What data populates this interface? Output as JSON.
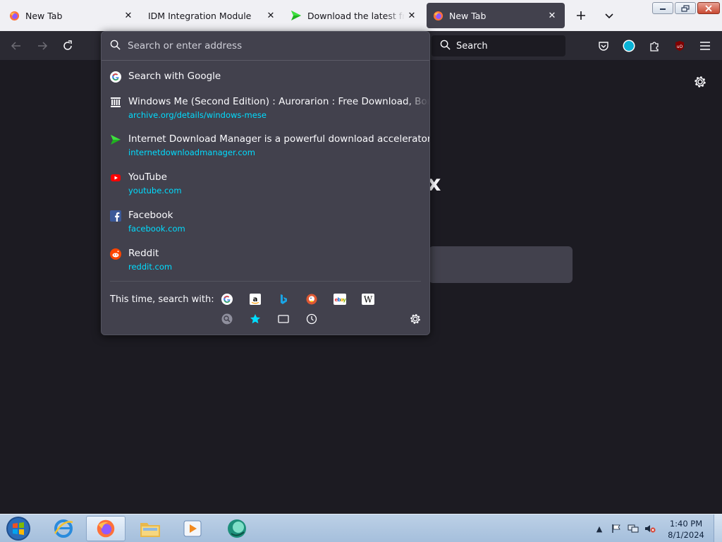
{
  "tabs": [
    {
      "title": "New Tab",
      "icon": "firefox-icon",
      "active": false
    },
    {
      "title": "IDM Integration Module",
      "icon": "none",
      "active": false
    },
    {
      "title": "Download the latest free trial",
      "icon": "idm-arrow-icon",
      "active": false
    },
    {
      "title": "New Tab",
      "icon": "firefox-icon",
      "active": true
    }
  ],
  "urlbar": {
    "placeholder": "Search or enter address"
  },
  "searchbar": {
    "placeholder": "Search"
  },
  "results": [
    {
      "title": "Search with Google",
      "url": "",
      "icon": "google-icon"
    },
    {
      "title": "Windows Me (Second Edition) : Aurorarion : Free Download, Borrow, and Streaming",
      "url": "archive.org/details/windows-mese",
      "icon": "archive-org-icon"
    },
    {
      "title": "Internet Download Manager is a powerful download accelerator",
      "url": "internetdownloadmanager.com",
      "icon": "idm-arrow-icon"
    },
    {
      "title": "YouTube",
      "url": "youtube.com",
      "icon": "youtube-icon"
    },
    {
      "title": "Facebook",
      "url": "facebook.com",
      "icon": "facebook-icon"
    },
    {
      "title": "Reddit",
      "url": "reddit.com",
      "icon": "reddit-icon"
    }
  ],
  "oneoff": {
    "label": "This time, search with:",
    "engines": [
      "google-icon",
      "amazon-icon",
      "bing-icon",
      "duckduckgo-icon",
      "ebay-icon",
      "wikipedia-icon"
    ],
    "modes": [
      "search-engines-icon",
      "bookmarks-star-icon",
      "tabs-icon",
      "history-clock-icon"
    ]
  },
  "content": {
    "logo_partial": "x"
  },
  "taskbar": {
    "time": "1:40 PM",
    "date": "8/1/2024"
  },
  "colors": {
    "accent": "#00ddff",
    "panel": "#42414d",
    "toolbar": "#2b2a33",
    "page": "#1c1b22"
  }
}
